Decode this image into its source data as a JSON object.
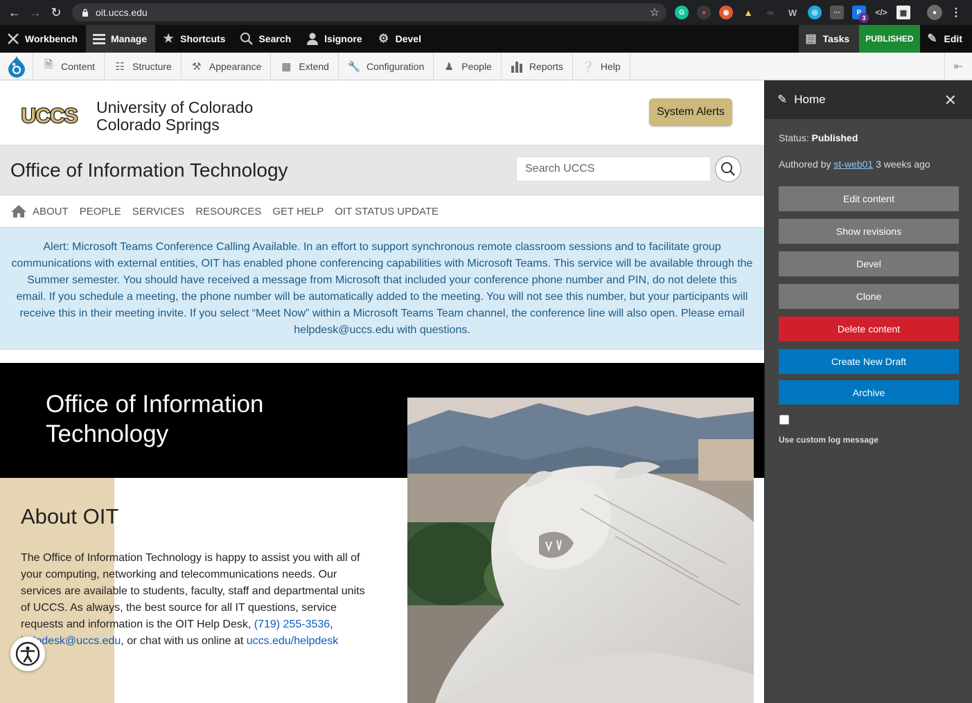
{
  "browser": {
    "url": "oit.uccs.edu",
    "ext_badge": "3"
  },
  "toolbar": {
    "workbench": "Workbench",
    "manage": "Manage",
    "shortcuts": "Shortcuts",
    "search": "Search",
    "user": "lsignore",
    "devel": "Devel",
    "tasks": "Tasks",
    "published": "PUBLISHED",
    "edit": "Edit"
  },
  "admin_menu": [
    {
      "label": "Content",
      "icon": "content-icon"
    },
    {
      "label": "Structure",
      "icon": "structure-icon"
    },
    {
      "label": "Appearance",
      "icon": "appearance-icon"
    },
    {
      "label": "Extend",
      "icon": "extend-icon"
    },
    {
      "label": "Configuration",
      "icon": "configuration-icon"
    },
    {
      "label": "People",
      "icon": "people-icon"
    },
    {
      "label": "Reports",
      "icon": "reports-icon"
    },
    {
      "label": "Help",
      "icon": "help-icon"
    }
  ],
  "site": {
    "logo_text": "UCCS",
    "university_line1": "University of Colorado",
    "university_line2": "Colorado Springs",
    "system_alerts": "System Alerts",
    "department": "Office of Information Technology",
    "search_placeholder": "Search UCCS",
    "nav": [
      "ABOUT",
      "PEOPLE",
      "SERVICES",
      "RESOURCES",
      "GET HELP",
      "OIT STATUS UPDATE"
    ],
    "alert": "Alert: Microsoft Teams Conference Calling Available. In an effort to support synchronous remote classroom sessions and to facilitate group communications with external entities, OIT has enabled phone conferencing capabilities with Microsoft Teams. This service will be available through the Summer semester. You should have received a message from Microsoft that included your conference phone number and PIN, do not delete this email. If you schedule a meeting, the phone number will be automatically added to the meeting. You will not see this number, but your participants will receive this in their meeting invite. If you select “Meet Now” within a Microsoft Teams Team channel, the conference line will also open. Please email helpdesk@uccs.edu with questions.",
    "hero_title": "Office of Information Technology",
    "about_title": "About OIT",
    "about_text": "The Office of Information Technology is happy to assist you with all of your computing, networking and telecommunications needs. Our services are available to students, faculty, staff and departmental units of UCCS. As always, the best source for all IT questions, service requests and information is the OIT Help Desk, ",
    "about_phone": "(719) 255-3536",
    "about_sep": ",",
    "about_email": "helpdesk@uccs.edu",
    "about_mid": ", or chat with us online at ",
    "about_link": "uccs.edu/helpdesk"
  },
  "sidebar": {
    "title": "Home",
    "status_label": "Status:",
    "status_value": "Published",
    "authored_prefix": "Authored by",
    "author": "st-web01",
    "authored_suffix": "3 weeks ago",
    "buttons": [
      "Edit content",
      "Show revisions",
      "Devel",
      "Clone",
      "Delete content",
      "Create New Draft",
      "Archive"
    ],
    "log_message": "Use custom log message"
  },
  "colors": {
    "published_green": "#1d8a34",
    "delete_red": "#d21f2c",
    "draft_blue": "#0077c0",
    "uccs_gold": "#cfb87c"
  }
}
